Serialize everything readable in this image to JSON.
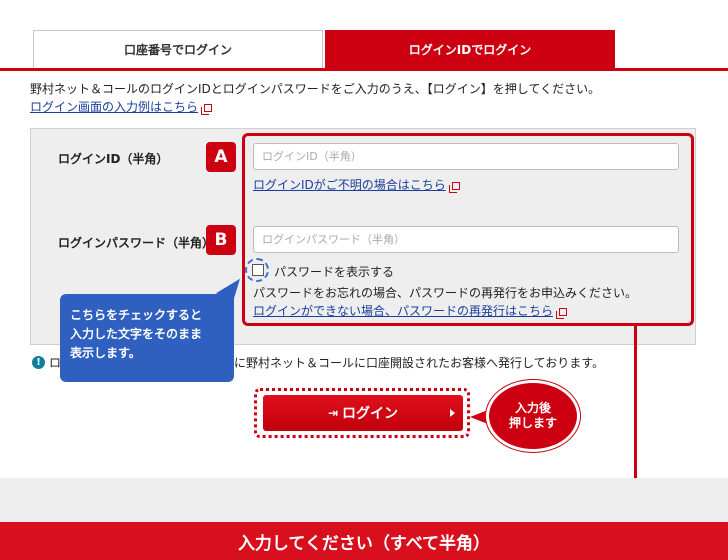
{
  "tabs": [
    {
      "label": "口座番号でログイン",
      "active": false
    },
    {
      "label": "ログインIDでログイン",
      "active": true
    }
  ],
  "intro_text": "野村ネット＆コールのログインIDとログインパスワードをご入力のうえ、【ログイン】を押してください。",
  "example_link": "ログイン画面の入力例はこちら",
  "form": {
    "id_label": "ログインID（半角）",
    "id_badge": "A",
    "id_placeholder": "ログインID（半角）",
    "forgot_id_link": "ログインIDがご不明の場合はこちら",
    "pw_label": "ログインパスワード（半角）",
    "pw_badge": "B",
    "pw_placeholder": "ログインパスワード（半角）",
    "show_password_label": "パスワードを表示する",
    "forgot_pw_note": "パスワードをお忘れの場合、パスワードの再発行をお申込みください。",
    "reissue_link": "ログインができない場合、パスワードの再発行はこちら"
  },
  "callout": {
    "line1": "こちらをチェックすると",
    "line2": "入力した文字をそのまま",
    "line3": "表示します。"
  },
  "notice": {
    "prefix": "ロ",
    "text": "に野村ネット＆コールに口座開設されたお客様へ発行しております。"
  },
  "login_button": "ログイン",
  "press_bubble": {
    "line1": "入力後",
    "line2": "押します"
  },
  "bottom_banner": "入力してください（すべて半角）",
  "colors": {
    "accent": "#cc0010",
    "link": "#1a3e9c",
    "callout": "#2f5fbf"
  }
}
